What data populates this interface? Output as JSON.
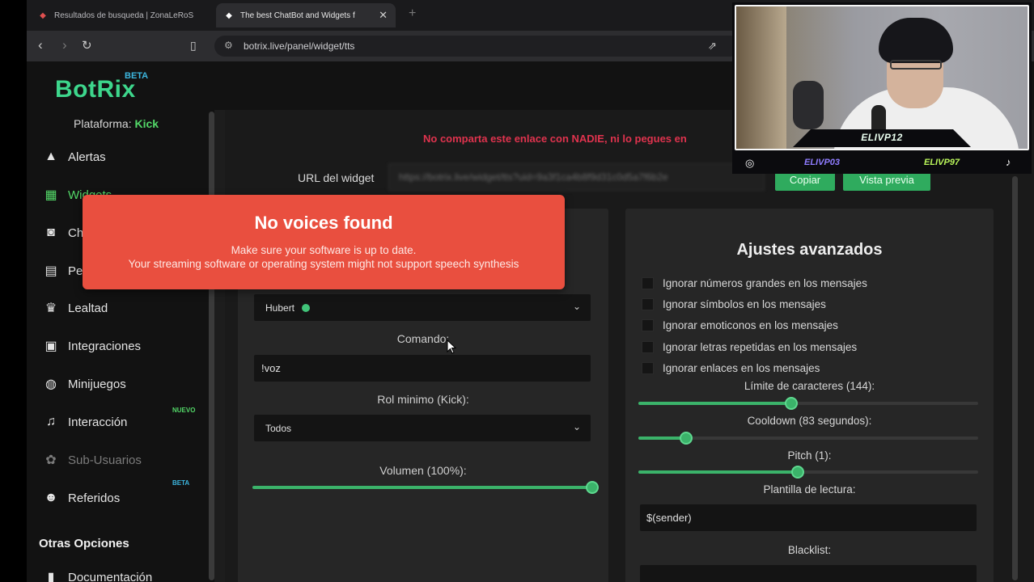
{
  "browser": {
    "tabs": [
      {
        "title": "Resultados de busqueda | ZonaLeRoS"
      },
      {
        "title": "The best ChatBot and Widgets f"
      }
    ],
    "new_tab": "+",
    "url": "botrix.live/panel/widget/tts"
  },
  "app": {
    "logo": "BotRix",
    "logo_tag": "BETA",
    "platform_label": "Plataforma:",
    "platform_value": "Kick",
    "sidebar": [
      {
        "label": "Alertas",
        "icon": "warning-icon",
        "state": "normal"
      },
      {
        "label": "Widgets",
        "icon": "grid-icon",
        "state": "active"
      },
      {
        "label": "Ch",
        "icon": "robot-icon",
        "state": "normal"
      },
      {
        "label": "Pe",
        "icon": "id-card-icon",
        "state": "normal"
      },
      {
        "label": "Lealtad",
        "icon": "trophy-icon",
        "state": "normal"
      },
      {
        "label": "Integraciones",
        "icon": "chat-icon",
        "state": "normal"
      },
      {
        "label": "Minijuegos",
        "icon": "gamepad-icon",
        "state": "normal"
      },
      {
        "label": "Interacción",
        "icon": "music-icon",
        "state": "normal",
        "badge": "NUEVO"
      },
      {
        "label": "Sub-Usuarios",
        "icon": "users-icon",
        "state": "muted"
      },
      {
        "label": "Referidos",
        "icon": "people-icon",
        "state": "normal",
        "badge": "BETA"
      }
    ],
    "section_title": "Otras Opciones",
    "doc_item": "Documentación",
    "badge_colors": {
      "nuevo": "#53d868",
      "beta": "#3cb7e0"
    }
  },
  "main": {
    "warning": "No comparta este enlace con NADIE, ni lo pegues en",
    "url_label": "URL del widget",
    "url_value": "https://botrix.live/widget/tts?uid=9a3f1ca4b8f9d31c0d5a7f6b2e",
    "copy_button": "Copiar",
    "preview_button": "Vista previa",
    "left": {
      "voice_value": "Hubert",
      "command_label": "Comando:",
      "command_value": "!voz",
      "role_label": "Rol minimo (Kick):",
      "role_value": "Todos",
      "volume_label": "Volumen (100%):",
      "volume": 1.0
    },
    "right": {
      "title": "Ajustes avanzados",
      "checks": [
        "Ignorar números grandes en los mensajes",
        "Ignorar símbolos en los mensajes",
        "Ignorar emoticonos en los mensajes",
        "Ignorar letras repetidas en los mensajes",
        "Ignorar enlaces en los mensajes"
      ],
      "char_limit_label": "Límite de caracteres (144):",
      "char_limit": 0.45,
      "cooldown_label": "Cooldown (83 segundos):",
      "cooldown": 0.14,
      "pitch_label": "Pitch (1):",
      "pitch": 0.47,
      "template_label": "Plantilla de lectura:",
      "template_value": "$(sender)",
      "blacklist_label": "Blacklist:"
    }
  },
  "toast": {
    "title": "No voices found",
    "line1": "Make sure your software is up to date.",
    "line2": "Your streaming software or operating system might not support speech synthesis"
  },
  "webcam": {
    "name": "ELIVP12",
    "handle_left": "ELIVP03",
    "handle_right": "ELIVP97",
    "handle_left_color": "#8f7cff",
    "handle_right_color": "#b9f55a"
  },
  "colors": {
    "accent": "#3dd68c",
    "button": "#2fab5e",
    "toast": "#e94f3f",
    "warning": "#e0334e"
  }
}
